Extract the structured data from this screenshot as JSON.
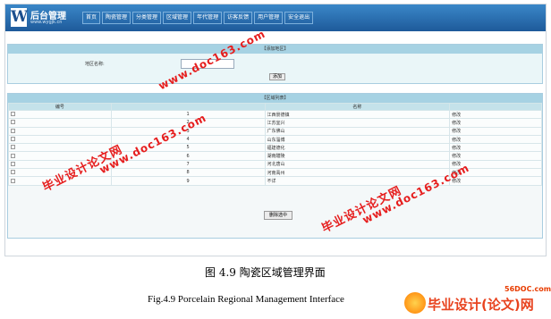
{
  "header": {
    "logo_letter": "W",
    "title": "后台管理",
    "url": "www.wygjk.cn",
    "nav": [
      "首页",
      "陶瓷管理",
      "分类管理",
      "区域管理",
      "年代管理",
      "访客反馈",
      "用户管理",
      "安全退出"
    ]
  },
  "add_panel": {
    "title": "【添加地区】",
    "field_label": "地区名称:",
    "field_value": "",
    "add_label": "添加"
  },
  "list_panel": {
    "title": "【区域列表】",
    "columns": [
      "编号",
      "名称"
    ],
    "rows": [
      {
        "id": "1",
        "name": "江西景德镇",
        "action": "修改"
      },
      {
        "id": "2",
        "name": "江苏宜兴",
        "action": "修改"
      },
      {
        "id": "3",
        "name": "广东佛山",
        "action": "修改"
      },
      {
        "id": "4",
        "name": "山东淄博",
        "action": "修改"
      },
      {
        "id": "5",
        "name": "福建德化",
        "action": "修改"
      },
      {
        "id": "6",
        "name": "湖南醴陵",
        "action": "修改"
      },
      {
        "id": "7",
        "name": "河北唐山",
        "action": "修改"
      },
      {
        "id": "8",
        "name": "河南禹州",
        "action": "修改"
      },
      {
        "id": "9",
        "name": "不详",
        "action": "修改"
      }
    ],
    "delete_label": "删除选中"
  },
  "watermarks": {
    "url": "www.doc163.com",
    "name": "毕业设计论文网"
  },
  "captions": {
    "cn": "图 4.9 陶瓷区域管理界面",
    "en": "Fig.4.9 Porcelain Regional Management Interface"
  },
  "site_logo": {
    "url": "56DOC.com",
    "name": "毕业设计(论文)网"
  },
  "colors": {
    "header": "#1e5a9a",
    "panel_head": "#a6d2e3",
    "watermark": "#e61e1e"
  }
}
